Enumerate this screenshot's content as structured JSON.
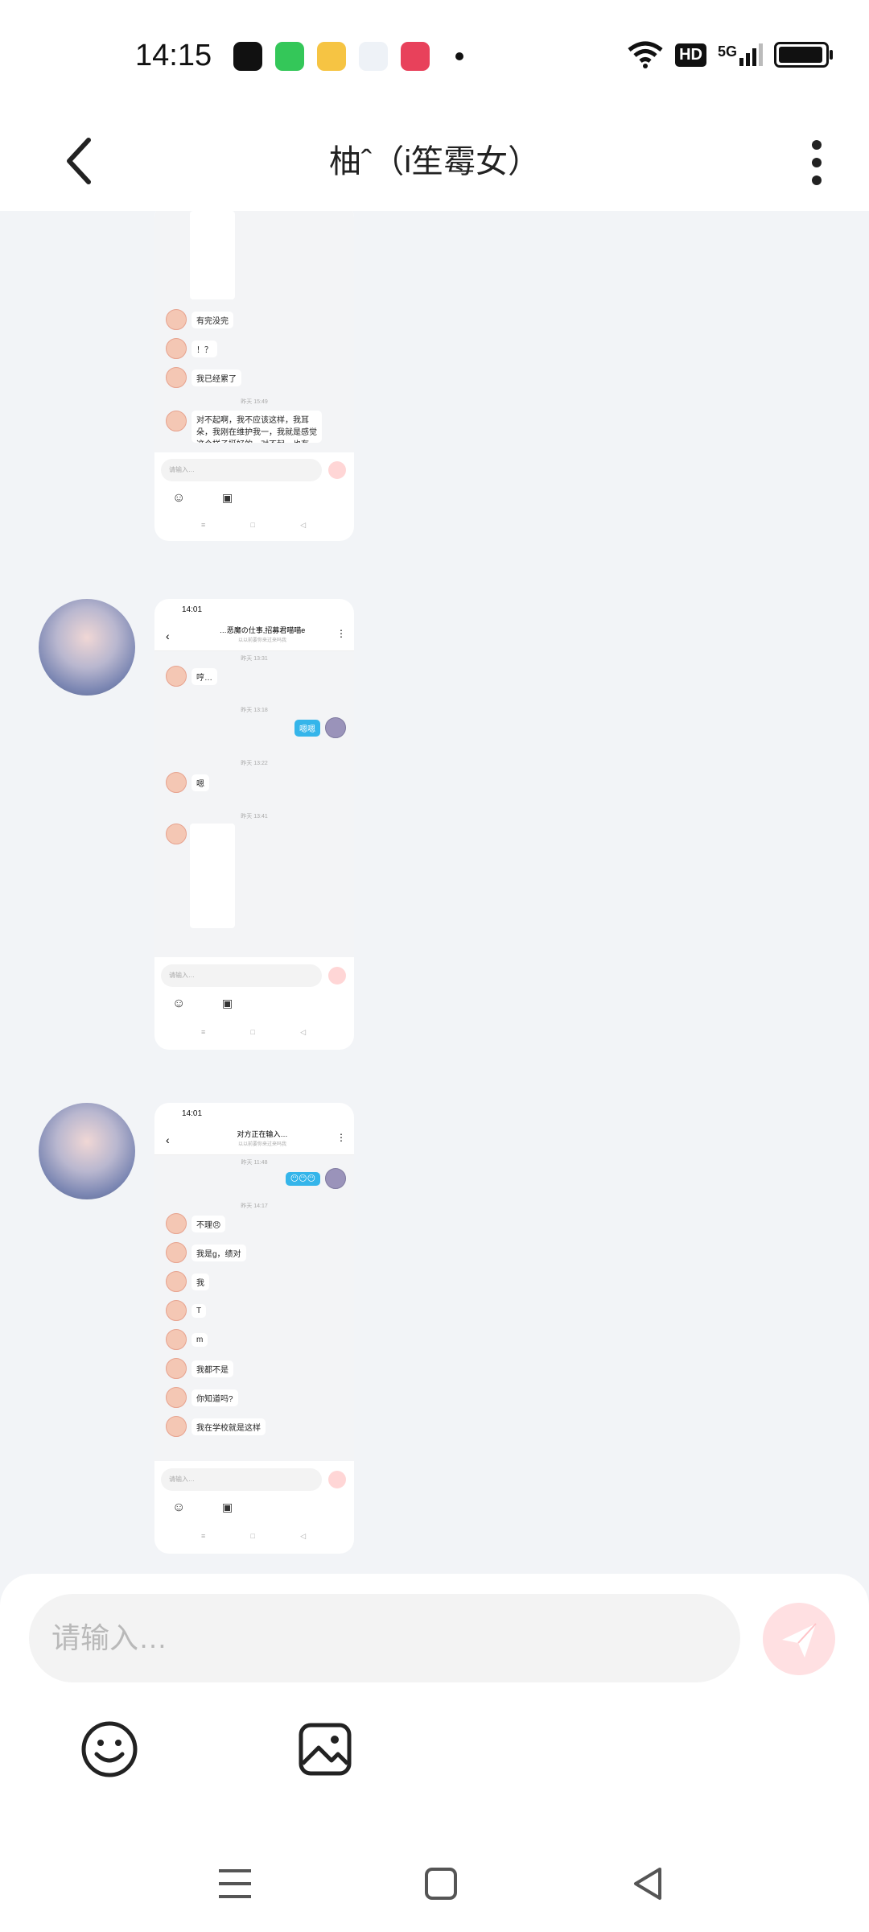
{
  "status_bar": {
    "time": "14:15",
    "network": "5G",
    "hd": "HD"
  },
  "header": {
    "title": "柚ˆ（i笙霉女）"
  },
  "messages": [
    {
      "type": "screenshot",
      "lines": [
        "有完没完",
        "！？",
        "我已经累了"
      ],
      "time": "昨天 15:49",
      "long_text": "对不起啊，我不应该这样，我耳朵，我刚在维护我一，我就是感觉这个样子挺好的，对不起，也有",
      "input_placeholder": "请输入…"
    },
    {
      "type": "screenshot",
      "mini_time": "14:01",
      "mini_title": "…恶魔の仕事,招募君喵喵e",
      "mini_subtitle": "以以前要你来过来吗我",
      "times": [
        "昨天 13:31",
        "昨天 13:18",
        "昨天 13:22",
        "昨天 13:41"
      ],
      "lines": [
        "哼…",
        "嗯嗯",
        "嗯"
      ],
      "input_placeholder": "请输入…"
    },
    {
      "type": "screenshot",
      "mini_time": "14:01",
      "mini_title": "对方正在输入…",
      "mini_subtitle": "以以前要你来过来吗我",
      "times": [
        "昨天 11:48",
        "昨天 14:17"
      ],
      "sent_emoji": "😶😶😶",
      "lines": [
        "不理😠",
        "我是g，绩对",
        "我",
        "T",
        "m",
        "我都不是",
        "你知道吗?",
        "我在学校就是这样"
      ],
      "input_placeholder": "请输入…"
    }
  ],
  "composer": {
    "placeholder": "请输入…"
  },
  "colors": {
    "accent_send": "#ffb7bd",
    "bubble_sent": "#35b5ea"
  }
}
